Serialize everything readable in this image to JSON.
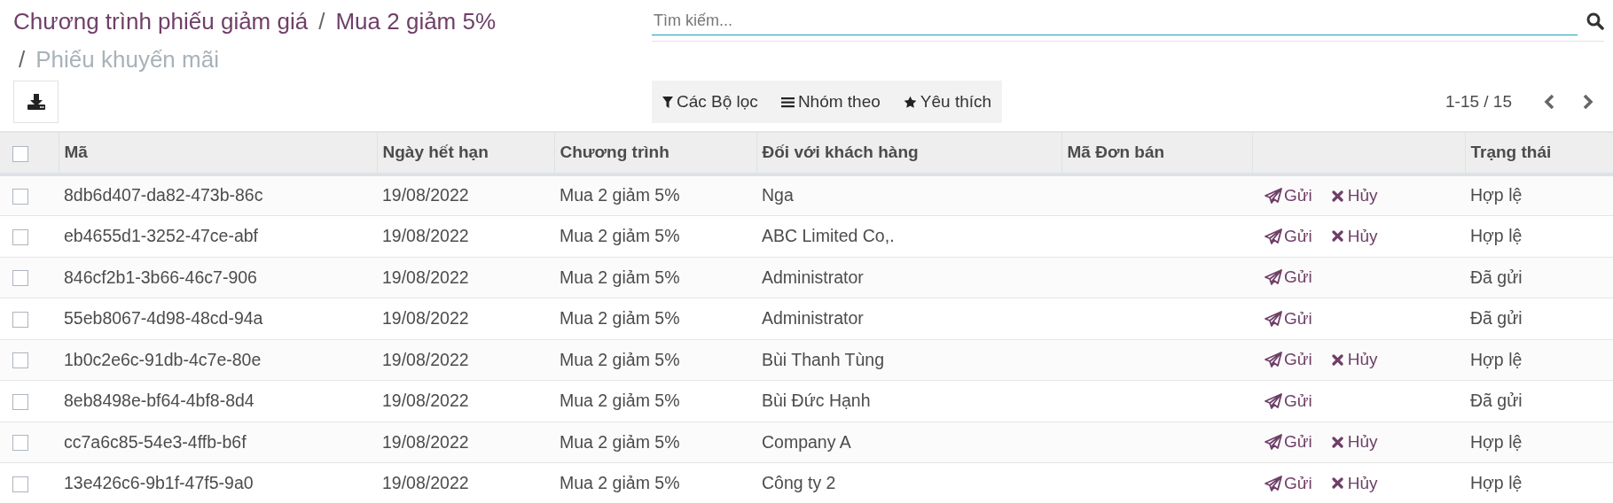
{
  "breadcrumb": [
    {
      "label": "Chương trình phiếu giảm giá",
      "current": false
    },
    {
      "separator": "/",
      "label": "Mua 2 giảm 5%",
      "current": false
    },
    {
      "separator": "/",
      "label": "Phiếu khuyến mãi",
      "current": true
    }
  ],
  "search": {
    "placeholder": "Tìm kiếm..."
  },
  "filters": [
    {
      "kind": "filter",
      "label": "Các Bộ lọc"
    },
    {
      "kind": "group",
      "label": "Nhóm theo"
    },
    {
      "kind": "favorite",
      "label": "Yêu thích"
    }
  ],
  "pager": "1-15 / 15",
  "table": {
    "select_all_checked": false,
    "columns": [
      "Mã",
      "Ngày hết hạn",
      "Chương trình",
      "Đối với khách hàng",
      "Mã Đơn bán",
      "Trạng thái"
    ],
    "rows": [
      {
        "checked": false,
        "code": "8db6d407-da82-473b-86c",
        "expiry": "19/08/2022",
        "program": "Mua 2 giảm 5%",
        "customer": "Nga",
        "send": "Gửi",
        "cancel": "Hủy",
        "status": "Hợp lệ"
      },
      {
        "checked": false,
        "code": "eb4655d1-3252-47ce-abf",
        "expiry": "19/08/2022",
        "program": "Mua 2 giảm 5%",
        "customer": "ABC Limited Co,.",
        "send": "Gửi",
        "cancel": "Hủy",
        "status": "Hợp lệ"
      },
      {
        "checked": false,
        "code": "846cf2b1-3b66-46c7-906",
        "expiry": "19/08/2022",
        "program": "Mua 2 giảm 5%",
        "customer": "Administrator",
        "send": "Gửi",
        "status": "Đã gửi"
      },
      {
        "checked": false,
        "code": "55eb8067-4d98-48cd-94a",
        "expiry": "19/08/2022",
        "program": "Mua 2 giảm 5%",
        "customer": "Administrator",
        "send": "Gửi",
        "status": "Đã gửi"
      },
      {
        "checked": false,
        "code": "1b0c2e6c-91db-4c7e-80e",
        "expiry": "19/08/2022",
        "program": "Mua 2 giảm 5%",
        "customer": "Bùi Thanh Tùng",
        "send": "Gửi",
        "cancel": "Hủy",
        "status": "Hợp lệ"
      },
      {
        "checked": false,
        "code": "8eb8498e-bf64-4bf8-8d4",
        "expiry": "19/08/2022",
        "program": "Mua 2 giảm 5%",
        "customer": "Bùi Đức Hạnh",
        "send": "Gửi",
        "status": "Đã gửi"
      },
      {
        "checked": false,
        "code": "cc7a6c85-54e3-4ffb-b6f",
        "expiry": "19/08/2022",
        "program": "Mua 2 giảm 5%",
        "customer": "Company A",
        "send": "Gửi",
        "cancel": "Hủy",
        "status": "Hợp lệ"
      },
      {
        "checked": false,
        "code": "13e426c6-9b1f-47f5-9a0",
        "expiry": "19/08/2022",
        "program": "Mua 2 giảm 5%",
        "customer": "Công ty 2",
        "send": "Gửi",
        "cancel": "Hủy",
        "status": "Hợp lệ"
      }
    ]
  }
}
